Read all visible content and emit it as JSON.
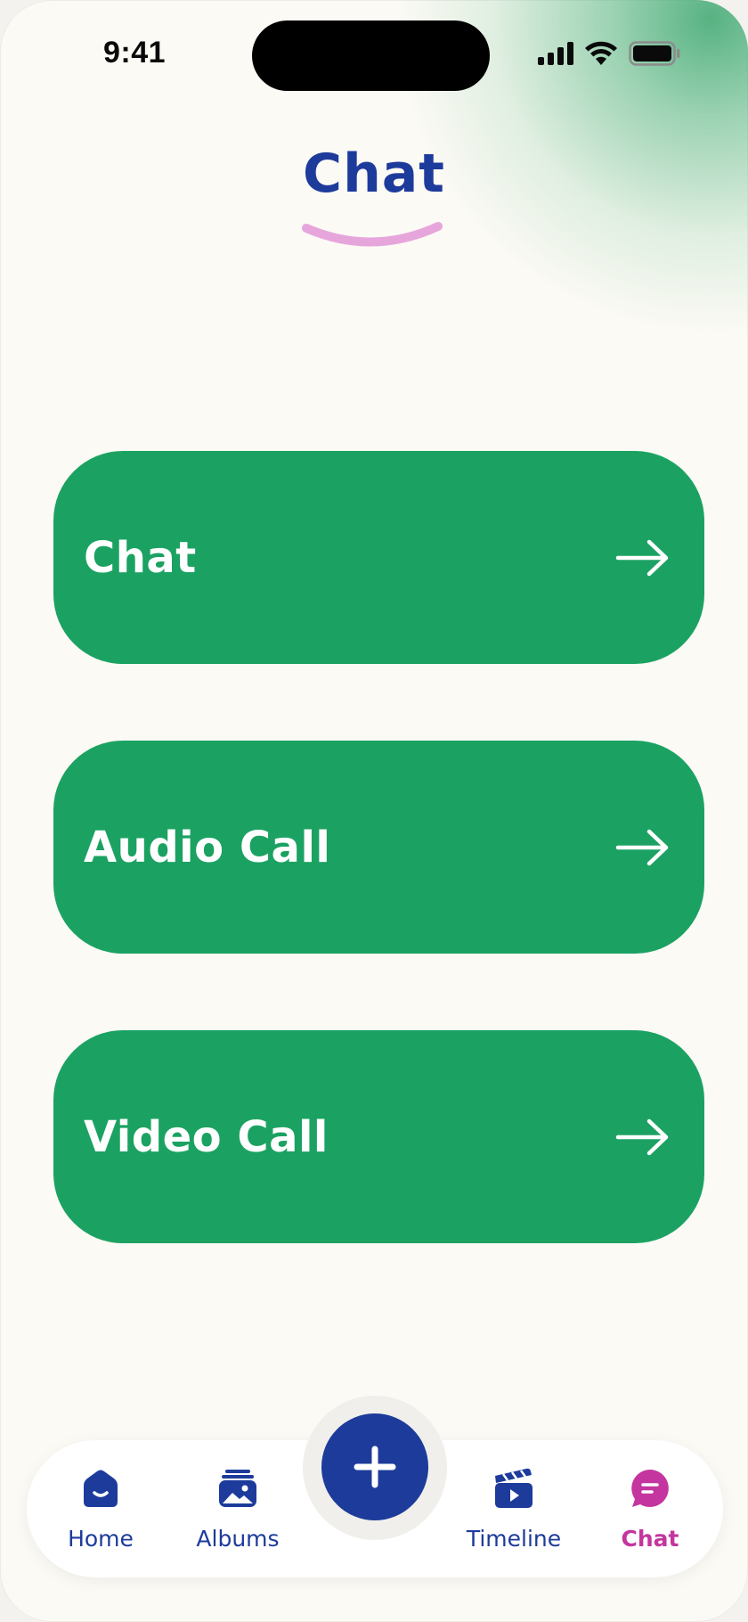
{
  "status_bar": {
    "time": "9:41",
    "icons": [
      "cellular-signal-icon",
      "wifi-icon",
      "battery-icon"
    ]
  },
  "header": {
    "title": "Chat"
  },
  "actions": [
    {
      "label": "Chat",
      "icon": "arrow-right-icon"
    },
    {
      "label": "Audio Call",
      "icon": "arrow-right-icon"
    },
    {
      "label": "Video Call",
      "icon": "arrow-right-icon"
    }
  ],
  "bottom_nav": {
    "items": [
      {
        "label": "Home",
        "icon": "home-icon",
        "active": false
      },
      {
        "label": "Albums",
        "icon": "albums-icon",
        "active": false
      },
      {
        "label": "Timeline",
        "icon": "timeline-icon",
        "active": false
      },
      {
        "label": "Chat",
        "icon": "chat-bubble-icon",
        "active": true
      }
    ],
    "fab_icon": "plus-icon"
  },
  "colors": {
    "primary_blue": "#1d3b9b",
    "card_green": "#1ba262",
    "accent_pink": "#c4359f",
    "underline_pink": "#e6a6dc",
    "background": "#fcfaf5"
  }
}
